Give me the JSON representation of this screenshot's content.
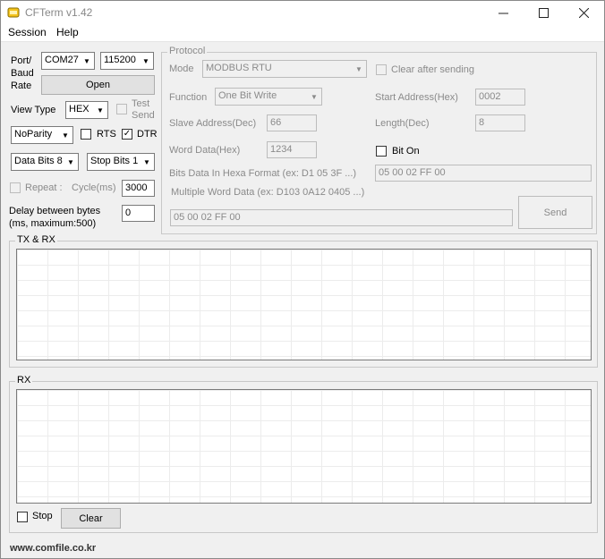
{
  "window": {
    "title": "CFTerm v1.42"
  },
  "menu": {
    "items": [
      "Session",
      "Help"
    ]
  },
  "port": {
    "label": "Port/\nBaud\nRate",
    "port_value": "COM27",
    "baud_value": "115200",
    "open_label": "Open"
  },
  "view": {
    "label": "View Type",
    "value": "HEX",
    "test_send_label": "Test\nSend"
  },
  "parity": {
    "value": "NoParity",
    "rts_label": "RTS",
    "dtr_label": "DTR"
  },
  "bits": {
    "data_bits": "Data Bits 8",
    "stop_bits": "Stop Bits 1"
  },
  "repeat": {
    "label": "Repeat :",
    "cycle_label": "Cycle(ms)",
    "cycle_value": "3000"
  },
  "delay": {
    "label": "Delay between bytes\n(ms, maximum:500)",
    "value": "0"
  },
  "protocol": {
    "title": "Protocol",
    "mode_label": "Mode",
    "mode_value": "MODBUS RTU",
    "clear_after_label": "Clear after sending",
    "function_label": "Function",
    "function_value": "One Bit Write",
    "start_address_label": "Start Address(Hex)",
    "start_address_value": "0002",
    "slave_address_label": "Slave Address(Dec)",
    "slave_address_value": "66",
    "length_label": "Length(Dec)",
    "length_value": "8",
    "word_data_label": "Word Data(Hex)",
    "word_data_value": "1234",
    "bit_on_label": "Bit On",
    "bits_hex_label": "Bits Data In Hexa Format (ex: D1 05 3F ...)",
    "bits_hex_value": "05 00 02 FF 00",
    "multi_word_label": "Multiple Word Data (ex: D103 0A12 0405 ...)",
    "multi_word_value": "05 00 02 FF 00",
    "send_label": "Send"
  },
  "txrx": {
    "title": "TX & RX"
  },
  "rx": {
    "title": "RX",
    "stop_label": "Stop",
    "clear_label": "Clear"
  },
  "status": {
    "url": "www.comfile.co.kr"
  },
  "colors": {
    "window_bg": "#f0f0f0",
    "disabled_text": "#8a8a8a"
  }
}
